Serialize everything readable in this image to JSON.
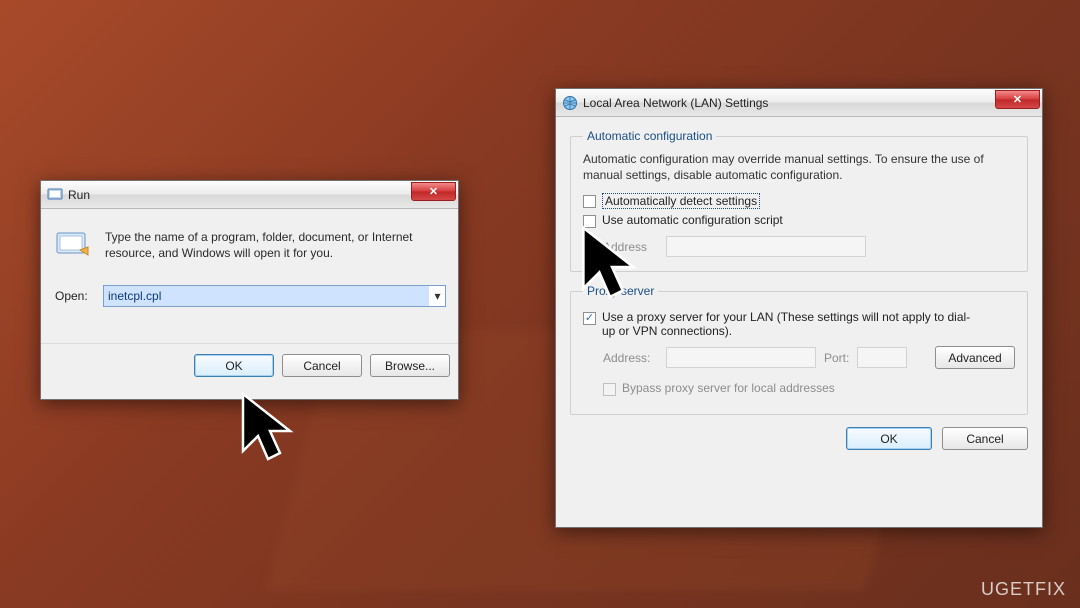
{
  "run": {
    "title": "Run",
    "description": "Type the name of a program, folder, document, or Internet resource, and Windows will open it for you.",
    "open_label": "Open:",
    "open_value": "inetcpl.cpl",
    "ok": "OK",
    "cancel": "Cancel",
    "browse": "Browse..."
  },
  "lan": {
    "title": "Local Area Network (LAN) Settings",
    "auto_group": "Automatic configuration",
    "auto_desc": "Automatic configuration may override manual settings.  To ensure the use of manual settings, disable automatic configuration.",
    "auto_detect": "Automatically detect settings",
    "auto_script": "Use automatic configuration script",
    "address_label": "Address",
    "proxy_group": "Proxy server",
    "proxy_use": "Use a proxy server for your LAN (These settings will not apply to dial-up or VPN connections).",
    "proxy_address_label": "Address:",
    "proxy_port_label": "Port:",
    "advanced": "Advanced",
    "bypass": "Bypass proxy server for local addresses",
    "ok": "OK",
    "cancel": "Cancel"
  },
  "watermark": "UGETFIX"
}
